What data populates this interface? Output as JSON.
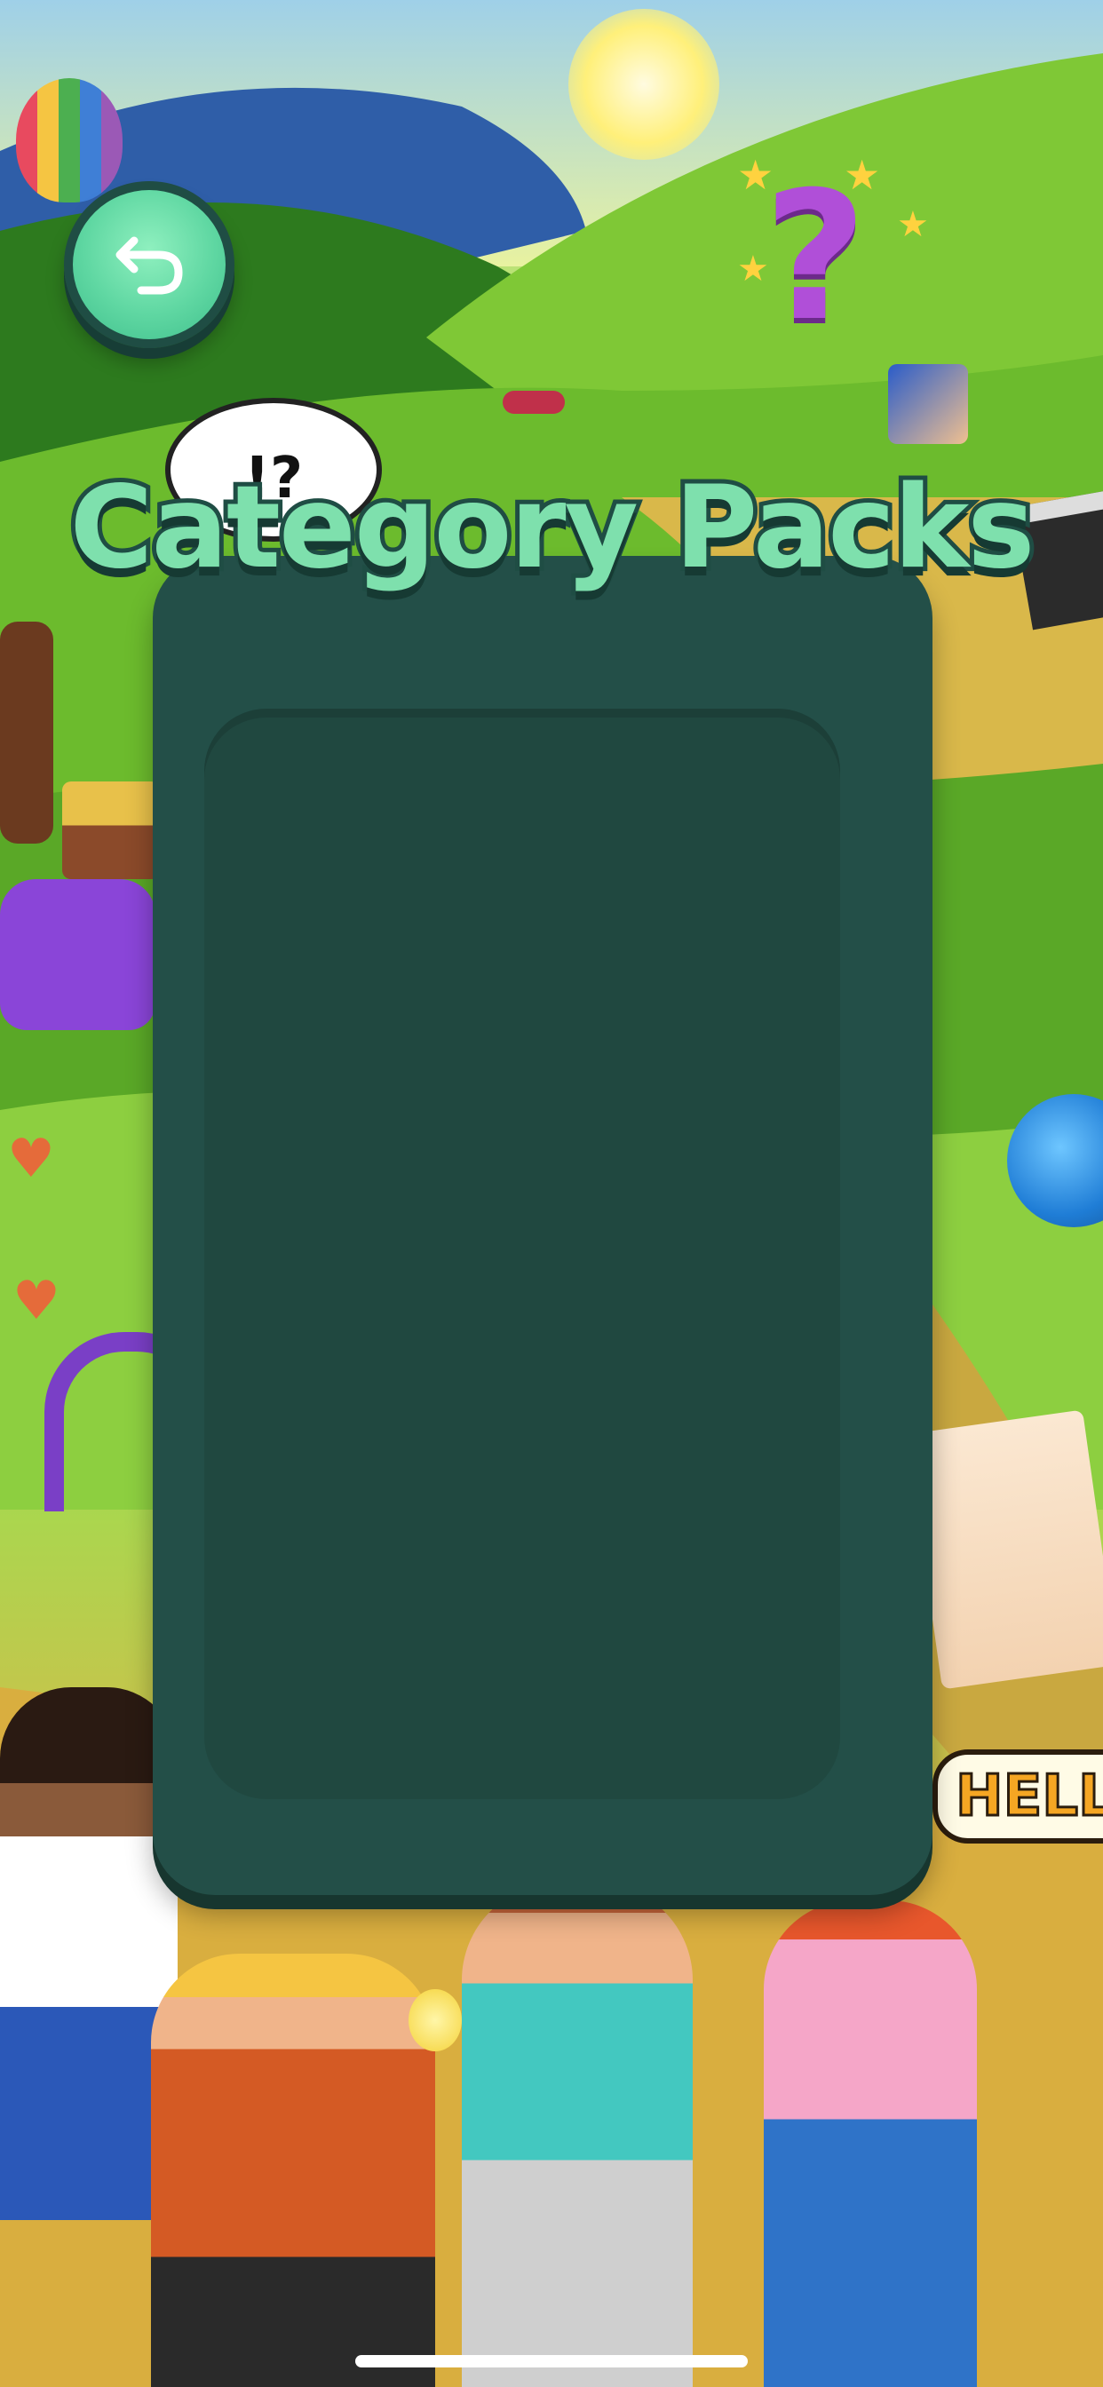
{
  "screen": {
    "title": "Category Packs",
    "back_button_icon": "back-arrow-icon"
  },
  "background": {
    "speech_bubble_text": "!?",
    "hello_badge_text": "HELLO!"
  },
  "colors": {
    "panel": "#234f48",
    "panel_inner": "#204840",
    "title_fill": "#7ee0ad",
    "title_stroke": "#1f4d44",
    "back_button": "#5fd7a2"
  },
  "category_packs": []
}
